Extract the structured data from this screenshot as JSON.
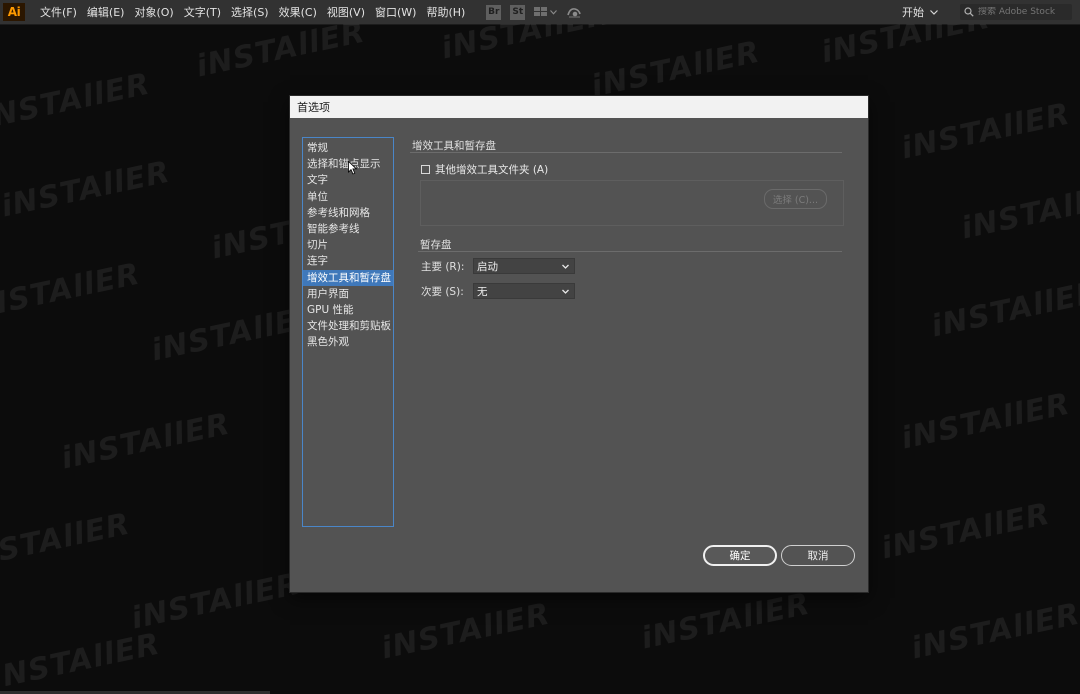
{
  "menubar": {
    "app_logo": "Ai",
    "items": [
      "文件(F)",
      "编辑(E)",
      "对象(O)",
      "文字(T)",
      "选择(S)",
      "效果(C)",
      "视图(V)",
      "窗口(W)",
      "帮助(H)"
    ],
    "bridge_label": "Br",
    "stock_label": "St",
    "arrange_icon": "layout-grid-icon",
    "gpu_icon": "gpu-performance-icon",
    "workspace": "开始",
    "search_placeholder": "搜索 Adobe Stock"
  },
  "watermark": {
    "text": "iNSTAllER"
  },
  "dialog": {
    "title": "首选项",
    "categories": [
      "常规",
      "选择和锚点显示",
      "文字",
      "单位",
      "参考线和网格",
      "智能参考线",
      "切片",
      "连字",
      "增效工具和暂存盘",
      "用户界面",
      "GPU 性能",
      "文件处理和剪贴板",
      "黑色外观"
    ],
    "selected_category": "增效工具和暂存盘",
    "plugins": {
      "title": "增效工具和暂存盘",
      "checkbox_label": "其他增效工具文件夹 (A)",
      "checked": false,
      "choose_button": "选择 (C)..."
    },
    "scratch": {
      "title": "暂存盘",
      "primary_label": "主要 (R):",
      "primary_value": "启动",
      "secondary_label": "次要 (S):",
      "secondary_value": "无"
    },
    "ok_button": "确定",
    "cancel_button": "取消"
  },
  "colors": {
    "menubar_bg": "#323232",
    "dialog_bg": "#535353",
    "selection": "#3f78ba",
    "list_border": "#4a86c8",
    "logo_orange": "#ff9a00"
  }
}
